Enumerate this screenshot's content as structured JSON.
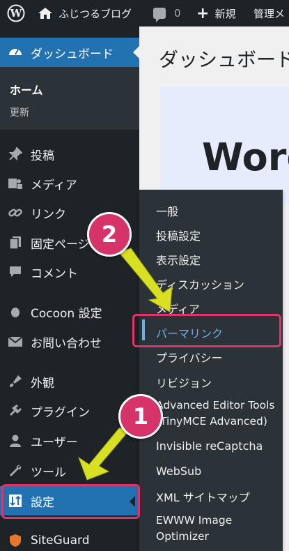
{
  "admin_bar": {
    "site_name": "ふじつるブログ",
    "comment_count": "0",
    "new_label": "新規",
    "admin_label": "管理メ"
  },
  "sidebar": {
    "dashboard": "ダッシュボード",
    "dashboard_sub": {
      "home": "ホーム",
      "update": "更新"
    },
    "items": [
      {
        "label": "投稿",
        "icon": "pin-icon"
      },
      {
        "label": "メディア",
        "icon": "media-icon"
      },
      {
        "label": "リンク",
        "icon": "link-icon"
      },
      {
        "label": "固定ページ",
        "icon": "page-icon"
      },
      {
        "label": "コメント",
        "icon": "comment-icon"
      },
      {
        "label": "Cocoon 設定",
        "icon": "cocoon-icon"
      },
      {
        "label": "お問い合わせ",
        "icon": "mail-icon"
      },
      {
        "label": "外観",
        "icon": "appearance-icon"
      },
      {
        "label": "プラグイン",
        "icon": "plugin-icon"
      },
      {
        "label": "ユーザー",
        "icon": "user-icon"
      },
      {
        "label": "ツール",
        "icon": "tool-icon"
      },
      {
        "label": "設定",
        "icon": "settings-icon"
      },
      {
        "label": "SiteGuard",
        "icon": "siteguard-icon"
      }
    ]
  },
  "main": {
    "page_title": "ダッシュボード",
    "welcome_text": "Word"
  },
  "flyout": {
    "items": [
      "一般",
      "投稿設定",
      "表示設定",
      "ディスカッション",
      "メディア",
      "パーマリンク",
      "プライバシー",
      "リビジョン",
      "Advanced Editor Tools",
      "(TinyMCE Advanced)",
      "Invisible reCaptcha",
      "WebSub",
      "XML サイトマップ",
      "EWWW Image",
      "Optimizer"
    ]
  },
  "annotations": {
    "badge1": "1",
    "badge2": "2"
  },
  "colors": {
    "admin_bar_bg": "#1d2327",
    "active_blue": "#2271b1",
    "highlight_pink": "#e0336a",
    "arrow_yellow": "#d9e021"
  }
}
